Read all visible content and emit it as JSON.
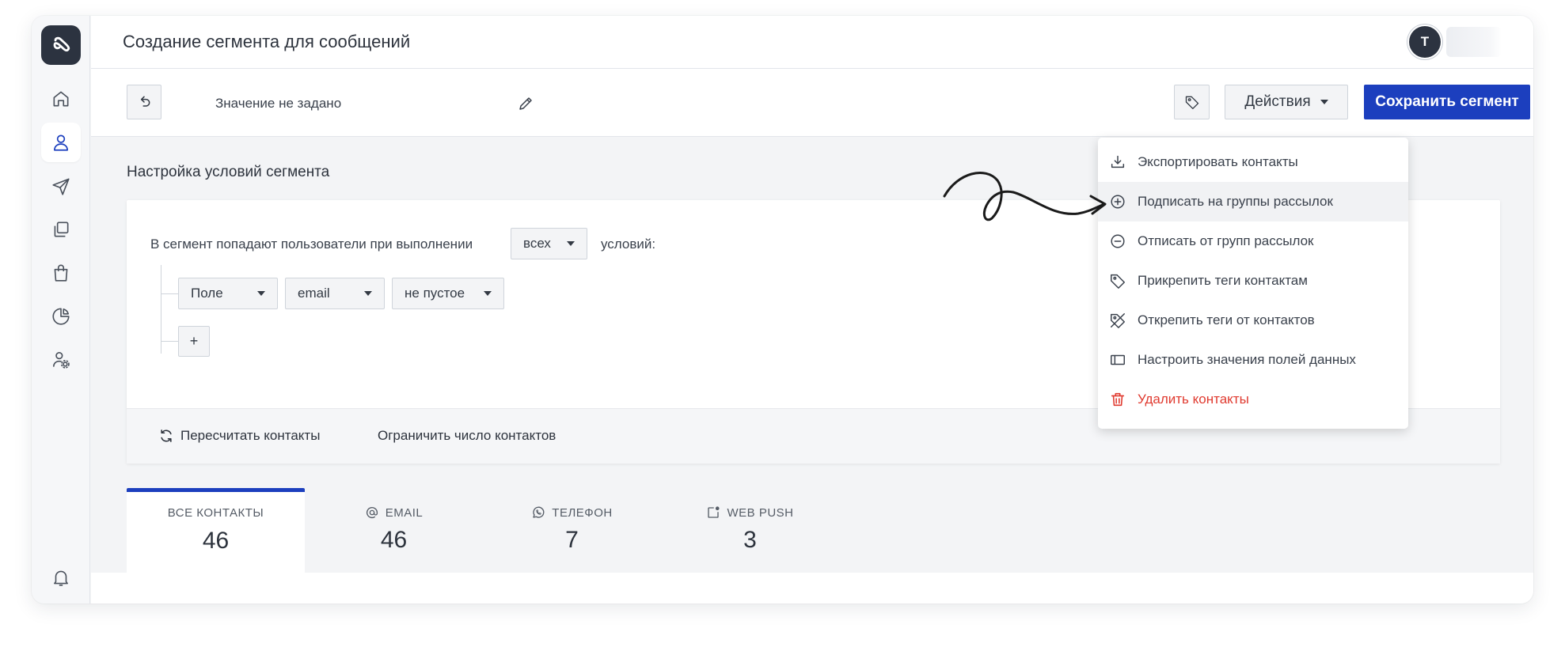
{
  "header": {
    "title": "Создание сегмента для сообщений",
    "avatar_initial": "T"
  },
  "sidebar": {
    "items": [
      {
        "name": "home-icon"
      },
      {
        "name": "user-icon",
        "active": true
      },
      {
        "name": "send-icon"
      },
      {
        "name": "templates-icon"
      },
      {
        "name": "shopping-bag-icon"
      },
      {
        "name": "pie-chart-icon"
      },
      {
        "name": "user-settings-icon"
      },
      {
        "name": "bell-icon"
      }
    ]
  },
  "toolbar": {
    "segment_name": "Значение не задано",
    "actions_label": "Действия",
    "save_label": "Сохранить сегмент"
  },
  "actions_menu": {
    "items": [
      {
        "label": "Экспортировать контакты",
        "icon": "download-icon"
      },
      {
        "label": "Подписать на группы рассылок",
        "icon": "plus-circle-icon",
        "hover": true
      },
      {
        "label": "Отписать от групп рассылок",
        "icon": "minus-circle-icon"
      },
      {
        "label": "Прикрепить теги контактам",
        "icon": "tag-icon"
      },
      {
        "label": "Открепить теги от контактов",
        "icon": "tag-off-icon"
      },
      {
        "label": "Настроить значения полей данных",
        "icon": "field-icon"
      },
      {
        "label": "Удалить контакты",
        "icon": "trash-icon",
        "danger": true,
        "color": "#e03a2f"
      }
    ]
  },
  "conditions": {
    "section_title": "Настройка условий сегмента",
    "rule_prefix": "В сегмент попадают пользователи при выполнении",
    "rule_match": "всех",
    "rule_suffix": "условий:",
    "row": {
      "field_type": "Поле",
      "field": "email",
      "operator": "не пустое"
    },
    "add_label": "+",
    "recalc_label": "Пересчитать контакты",
    "limit_label": "Ограничить число контактов"
  },
  "tabs": [
    {
      "label": "ВСЕ КОНТАКТЫ",
      "count": "46",
      "active": true
    },
    {
      "label": "EMAIL",
      "count": "46",
      "icon": "at-icon"
    },
    {
      "label": "ТЕЛЕФОН",
      "count": "7",
      "icon": "whatsapp-icon"
    },
    {
      "label": "WEB PUSH",
      "count": "3",
      "icon": "web-push-icon"
    }
  ],
  "colors": {
    "accent": "#1c3fbe",
    "danger": "#e03a2f",
    "logo_bg": "#2c3340"
  }
}
